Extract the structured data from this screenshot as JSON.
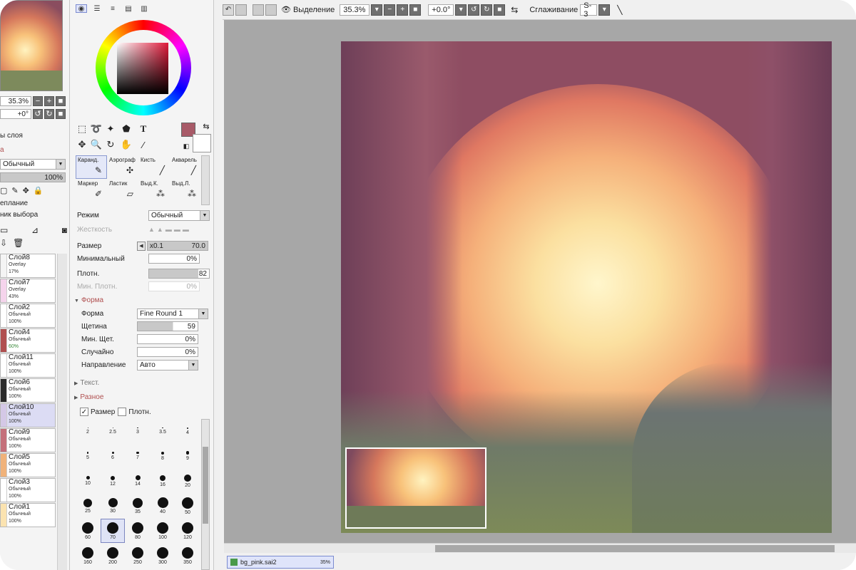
{
  "navigator": {
    "zoom": "35.3%",
    "angle": "+0°"
  },
  "layer_panel": {
    "properties_title": "ы слоя",
    "section_label": "а",
    "blend_mode": "Обычный",
    "opacity": "100%",
    "clipping_label": "еплание",
    "selection_source_label": "ник выбора",
    "layers": [
      {
        "name": "Слой8",
        "mode": "Overlay",
        "opacity": "17%",
        "color": "#f4f4f4"
      },
      {
        "name": "Слой7",
        "mode": "Overlay",
        "opacity": "43%",
        "color": "#f5d4ec"
      },
      {
        "name": "Слой2",
        "mode": "Обычный",
        "opacity": "100%",
        "color": "#ffffff"
      },
      {
        "name": "Слой4",
        "mode": "Обычный",
        "opacity": "60%",
        "color": "#b05050"
      },
      {
        "name": "Слой11",
        "mode": "Обычный",
        "opacity": "100%",
        "color": "#ffffff"
      },
      {
        "name": "Слой6",
        "mode": "Обычный",
        "opacity": "100%",
        "color": "#2a2a2a"
      },
      {
        "name": "Слой10",
        "mode": "Обычный",
        "opacity": "100%",
        "color": "#d4c8e6"
      },
      {
        "name": "Слой9",
        "mode": "Обычный",
        "opacity": "100%",
        "color": "#c4707a"
      },
      {
        "name": "Слой5",
        "mode": "Обычный",
        "opacity": "100%",
        "color": "#f0b27a"
      },
      {
        "name": "Слой3",
        "mode": "Обычный",
        "opacity": "100%",
        "color": "#ffffff"
      },
      {
        "name": "Слой1",
        "mode": "Обычный",
        "opacity": "100%",
        "color": "#fbe3b0"
      }
    ]
  },
  "colors": {
    "foreground": "#a85a68",
    "background": "#ffffff",
    "accent": "#b05050"
  },
  "brushes": [
    {
      "label": "Каранд.",
      "icon": "pencil-icon"
    },
    {
      "label": "Аэрограф",
      "icon": "airbrush-icon"
    },
    {
      "label": "Кисть",
      "icon": "brush-icon"
    },
    {
      "label": "Акварель",
      "icon": "watercolor-icon"
    },
    {
      "label": "Маркер",
      "icon": "marker-icon"
    },
    {
      "label": "Ластик",
      "icon": "eraser-icon"
    },
    {
      "label": "Выд.К.",
      "icon": "select-pen-icon"
    },
    {
      "label": "Выд.Л.",
      "icon": "deselect-pen-icon"
    }
  ],
  "tool_settings": {
    "mode_label": "Режим",
    "mode_value": "Обычный",
    "hardness_label": "Жесткость",
    "size_label": "Размер",
    "size_multiplier": "x0.1",
    "size_value": "70.0",
    "min_size_label": "Минимальный",
    "min_size_value": "0%",
    "density_label": "Плотн.",
    "density_value": "82",
    "min_density_label": "Мин. Плотн.",
    "min_density_value": "0%",
    "shape_section": "Форма",
    "shape_label": "Форма",
    "shape_value": "Fine Round 1",
    "bristle_label": "Щетина",
    "bristle_value": "59",
    "min_bristle_label": "Мин. Щет.",
    "min_bristle_value": "0%",
    "random_label": "Случайно",
    "random_value": "0%",
    "direction_label": "Направление",
    "direction_value": "Авто",
    "texture_section": "Текст.",
    "misc_section": "Разное",
    "size_check_label": "Размер",
    "density_check_label": "Плотн."
  },
  "brush_sizes": [
    "2",
    "2.5",
    "3",
    "3.5",
    "4",
    "5",
    "6",
    "7",
    "8",
    "9",
    "10",
    "12",
    "14",
    "16",
    "20",
    "25",
    "30",
    "35",
    "40",
    "50",
    "60",
    "70",
    "80",
    "100",
    "120",
    "160",
    "200",
    "250",
    "300",
    "350"
  ],
  "brush_sizes_selected": "70",
  "toolbar": {
    "selection_label": "Выделение",
    "zoom": "35.3%",
    "angle": "+0.0°",
    "smoothing_label": "Сглаживание",
    "smoothing_value": "S-3"
  },
  "status": {
    "filename": "bg_pink.sai2",
    "zoom": "35%"
  }
}
